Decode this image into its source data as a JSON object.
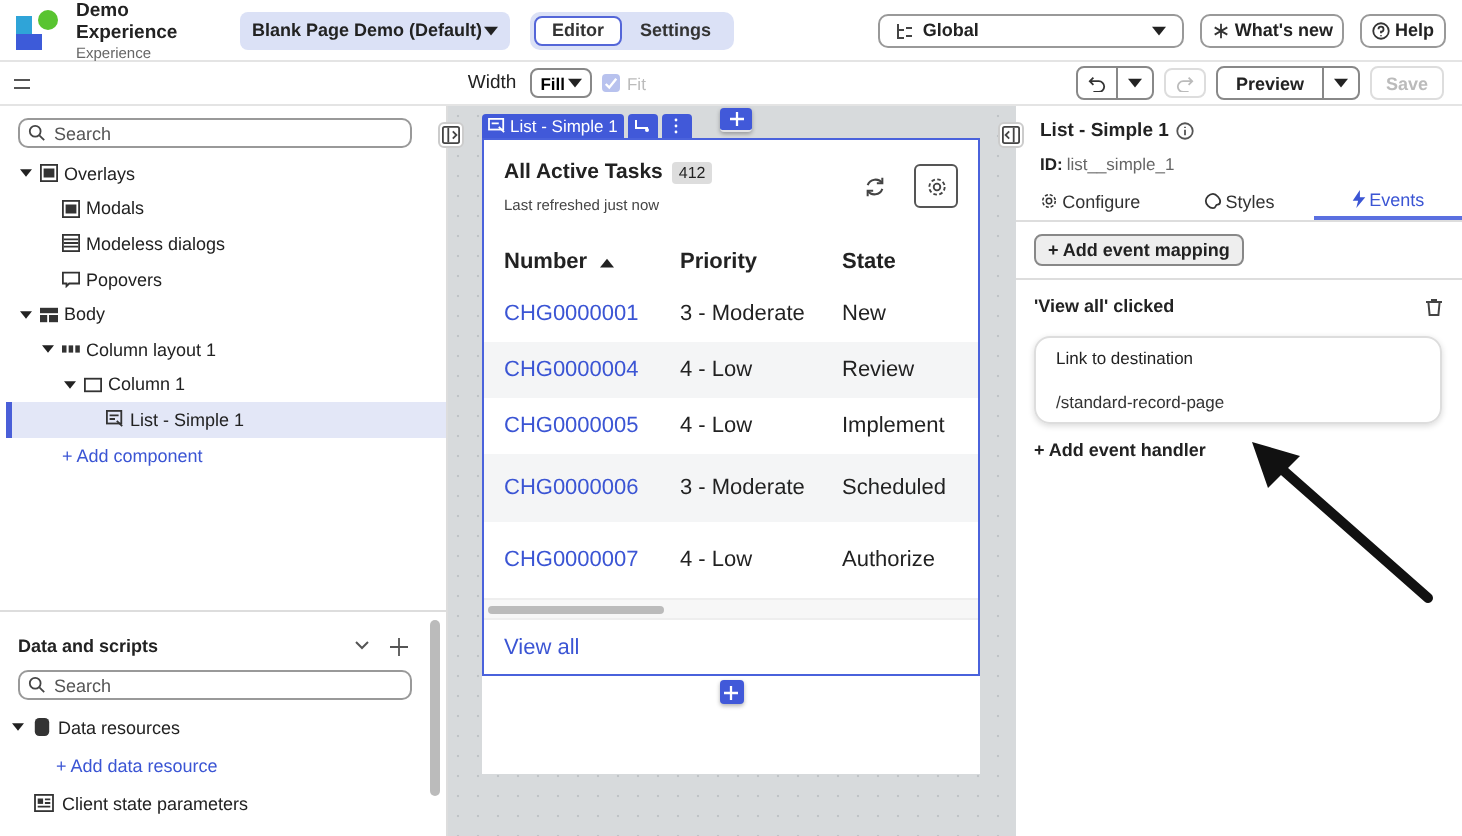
{
  "app": {
    "name": "Demo Experience",
    "subtitle": "Experience"
  },
  "page_selector": {
    "label": "Blank Page Demo (Default)"
  },
  "mode_tabs": [
    {
      "label": "Editor",
      "selected": true
    },
    {
      "label": "Settings",
      "selected": false
    }
  ],
  "scope_select": {
    "value": "Global"
  },
  "header_buttons": [
    {
      "kind": "whatsnew",
      "label": "What's new"
    },
    {
      "kind": "help",
      "label": "Help"
    }
  ],
  "toolbar": {
    "width_label": "Width",
    "width_select": "Fill",
    "fit": {
      "label": "Fit",
      "checked": true,
      "disabled": true
    },
    "preview": "Preview",
    "save": {
      "label": "Save",
      "disabled": true
    }
  },
  "tree_search": {
    "placeholder": "Search"
  },
  "tree": [
    {
      "label": "Overlays",
      "kind": "overlay",
      "expanded": true,
      "selected": false,
      "children": [
        {
          "label": "Modals",
          "kind": "overlay",
          "selected": false
        },
        {
          "label": "Modeless dialogs",
          "kind": "dialog",
          "selected": false
        },
        {
          "label": "Popovers",
          "kind": "popover",
          "selected": false
        }
      ]
    },
    {
      "label": "Body",
      "kind": "body",
      "expanded": true,
      "selected": false,
      "children": [
        {
          "label": "Column layout 1",
          "kind": "columns",
          "expanded": true,
          "selected": false,
          "children": [
            {
              "label": "Column 1",
              "kind": "column",
              "expanded": true,
              "selected": false,
              "children": [
                {
                  "label": "List - Simple 1",
                  "kind": "list",
                  "selected": true
                }
              ]
            }
          ]
        },
        {
          "label": "+ Add component",
          "kind": "add",
          "selected": false
        }
      ]
    }
  ],
  "data_panel": {
    "title": "Data and scripts",
    "search_placeholder": "Search",
    "items": [
      {
        "label": "Data resources",
        "kind": "database",
        "expanded": true
      },
      {
        "label": "+ Add data resource",
        "kind": "add"
      },
      {
        "label": "Client state parameters",
        "kind": "params"
      }
    ]
  },
  "canvas": {
    "component_tab": "List - Simple 1",
    "list": {
      "title": "All Active Tasks",
      "count": "412",
      "subtitle": "Last refreshed just now",
      "columns": [
        {
          "label": "Number",
          "sorted": true
        },
        {
          "label": "Priority",
          "sorted": false
        },
        {
          "label": "State",
          "sorted": false
        }
      ],
      "rows": [
        {
          "number": "CHG0000001",
          "priority": "3 - Moderate",
          "state": "New"
        },
        {
          "number": "CHG0000004",
          "priority": "4 - Low",
          "state": "Review"
        },
        {
          "number": "CHG0000005",
          "priority": "4 - Low",
          "state": "Implement"
        },
        {
          "number": "CHG0000006",
          "priority": "3 - Moderate",
          "state": "Scheduled"
        },
        {
          "number": "CHG0000007",
          "priority": "4 - Low",
          "state": "Authorize"
        }
      ],
      "view_all": "View all"
    }
  },
  "inspector": {
    "title": "List - Simple 1",
    "id_label": "ID:",
    "id_value": "list__simple_1",
    "tabs": [
      {
        "label": "Configure",
        "kind": "gear",
        "selected": false
      },
      {
        "label": "Styles",
        "kind": "drop",
        "selected": false
      },
      {
        "label": "Events",
        "kind": "bolt",
        "selected": true
      }
    ],
    "add_mapping": "+ Add event mapping",
    "event_title": "'View all' clicked",
    "handler": {
      "title": "Link to destination",
      "value": "/standard-record-page"
    },
    "add_handler": "+ Add event handler"
  }
}
